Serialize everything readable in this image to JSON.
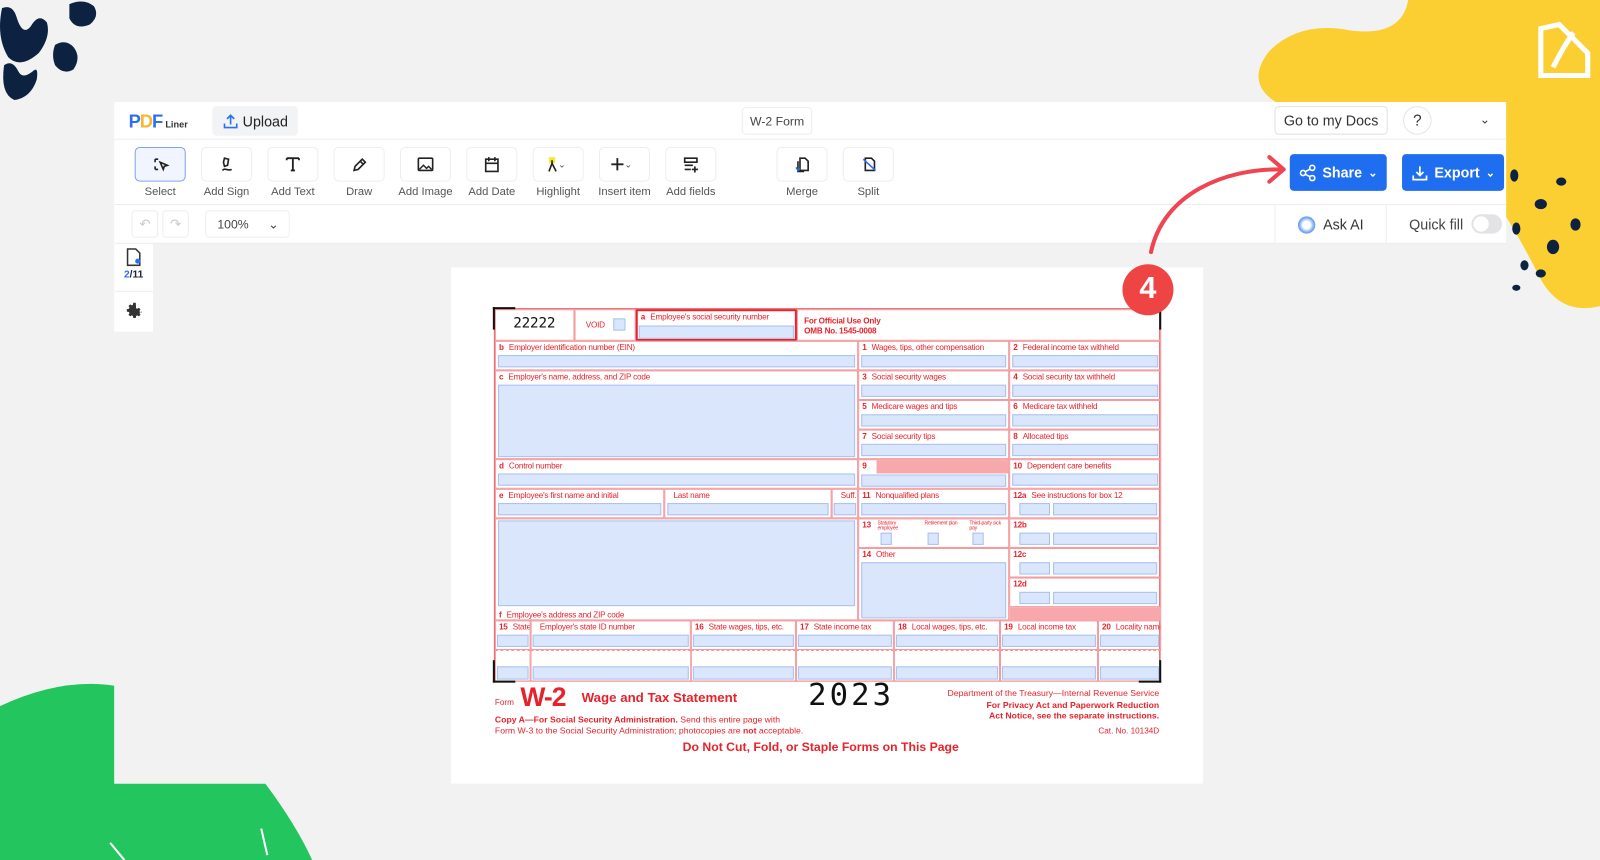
{
  "app": {
    "logo": "PDFLiner",
    "logo_pdf_p": "P",
    "logo_pdf_d": "D",
    "logo_pdf_f": "F",
    "logo_sub": "Liner",
    "upload": "Upload",
    "doc_title": "W-2 Form",
    "go_docs": "Go to my Docs",
    "help": "?"
  },
  "toolbar": {
    "tools": [
      {
        "label": "Select",
        "icon": "select-cursor-icon"
      },
      {
        "label": "Add Sign",
        "icon": "pen-sign-icon"
      },
      {
        "label": "Add Text",
        "icon": "text-icon"
      },
      {
        "label": "Draw",
        "icon": "pencil-icon"
      },
      {
        "label": "Add Image",
        "icon": "image-icon"
      },
      {
        "label": "Add Date",
        "icon": "calendar-icon"
      },
      {
        "label": "Highlight",
        "icon": "highlighter-icon"
      },
      {
        "label": "Insert item",
        "icon": "plus-icon"
      },
      {
        "label": "Add fields",
        "icon": "add-fields-icon"
      },
      {
        "label": "Merge",
        "icon": "merge-icon"
      },
      {
        "label": "Split",
        "icon": "split-icon"
      }
    ],
    "share": "Share",
    "export": "Export",
    "primary_color": "#1f6ef0"
  },
  "subbar": {
    "zoom": "100%",
    "ask_ai": "Ask AI",
    "quick_fill": "Quick fill",
    "quick_fill_on": false
  },
  "sidebar": {
    "page_current": "2",
    "page_total": "/11"
  },
  "annotation": {
    "step": "4",
    "color": "#ef4444"
  },
  "form": {
    "code": "22222",
    "void": "VOID",
    "official_1": "For Official Use Only",
    "official_2": "OMB No. 1545-0008",
    "boxes": {
      "a": {
        "n": "a",
        "t": "Employee's social security number"
      },
      "b": {
        "n": "b",
        "t": "Employer identification number (EIN)"
      },
      "c": {
        "n": "c",
        "t": "Employer's name, address, and ZIP code"
      },
      "d": {
        "n": "d",
        "t": "Control number"
      },
      "e": {
        "n": "e",
        "t": "Employee's first name and initial"
      },
      "last": {
        "n": "",
        "t": "Last name"
      },
      "suff": {
        "n": "",
        "t": "Suff."
      },
      "f": {
        "n": "f",
        "t": "Employee's address and ZIP code"
      },
      "b1": {
        "n": "1",
        "t": "Wages, tips, other compensation"
      },
      "b2": {
        "n": "2",
        "t": "Federal income tax withheld"
      },
      "b3": {
        "n": "3",
        "t": "Social security wages"
      },
      "b4": {
        "n": "4",
        "t": "Social security tax withheld"
      },
      "b5": {
        "n": "5",
        "t": "Medicare wages and tips"
      },
      "b6": {
        "n": "6",
        "t": "Medicare tax withheld"
      },
      "b7": {
        "n": "7",
        "t": "Social security tips"
      },
      "b8": {
        "n": "8",
        "t": "Allocated tips"
      },
      "b9": {
        "n": "9",
        "t": ""
      },
      "b10": {
        "n": "10",
        "t": "Dependent care benefits"
      },
      "b11": {
        "n": "11",
        "t": "Nonqualified plans"
      },
      "b12a": {
        "n": "12a",
        "t": "See instructions for box 12"
      },
      "b12b": {
        "n": "12b",
        "t": ""
      },
      "b12c": {
        "n": "12c",
        "t": ""
      },
      "b12d": {
        "n": "12d",
        "t": ""
      },
      "b13": {
        "n": "13",
        "t": ""
      },
      "b14": {
        "n": "14",
        "t": "Other"
      },
      "b15": {
        "n": "15",
        "t": "State"
      },
      "b15id": {
        "n": "",
        "t": "Employer's state ID number"
      },
      "b16": {
        "n": "16",
        "t": "State wages, tips, etc."
      },
      "b17": {
        "n": "17",
        "t": "State income tax"
      },
      "b18": {
        "n": "18",
        "t": "Local wages, tips, etc."
      },
      "b19": {
        "n": "19",
        "t": "Local income tax"
      },
      "b20": {
        "n": "20",
        "t": "Locality name"
      }
    },
    "b13_opts": [
      "Statutory employee",
      "Retirement plan",
      "Third-party sick pay"
    ],
    "footer": {
      "form_word": "Form",
      "form_name": "W-2",
      "title": "Wage and Tax Statement",
      "year": "2023",
      "dept": "Department of the Treasury—Internal Revenue Service",
      "privacy_1": "For Privacy Act and Paperwork Reduction",
      "privacy_2": "Act Notice, see the separate instructions.",
      "copy_bold": "Copy A—For Social Security Administration.",
      "copy_1": " Send this entire page with",
      "copy_2a": "Form W-3 to the Social Security Administration; photocopies are ",
      "copy_2b": "not",
      "copy_2c": " acceptable.",
      "cat": "Cat. No. 10134D",
      "warning": "Do Not Cut, Fold, or Staple Forms on This Page"
    }
  }
}
